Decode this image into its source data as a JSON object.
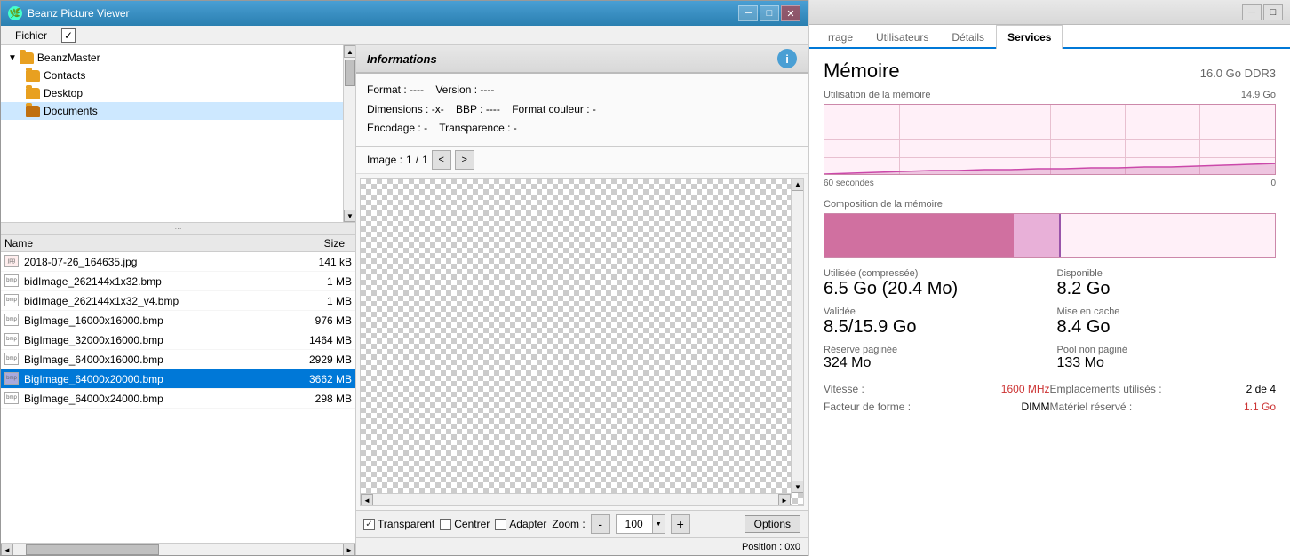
{
  "beanz": {
    "title": "Beanz Picture Viewer",
    "menu": {
      "fichier": "Fichier"
    },
    "tree": {
      "root": "BeanzMaster",
      "items": [
        {
          "name": "Contacts",
          "type": "folder"
        },
        {
          "name": "Desktop",
          "type": "folder"
        },
        {
          "name": "Documents",
          "type": "folder",
          "selected": true
        }
      ]
    },
    "file_list": {
      "headers": {
        "name": "Name",
        "size": "Size"
      },
      "files": [
        {
          "name": "2018-07-26_164635.jpg",
          "size": "141 kB",
          "selected": false
        },
        {
          "name": "bidImage_262144x1x32.bmp",
          "size": "1 MB",
          "selected": false
        },
        {
          "name": "bidImage_262144x1x32_v4.bmp",
          "size": "1 MB",
          "selected": false
        },
        {
          "name": "BigImage_16000x16000.bmp",
          "size": "976 MB",
          "selected": false
        },
        {
          "name": "BigImage_32000x16000.bmp",
          "size": "1464 MB",
          "selected": false
        },
        {
          "name": "BigImage_64000x16000.bmp",
          "size": "2929 MB",
          "selected": false
        },
        {
          "name": "BigImage_64000x20000.bmp",
          "size": "3662 MB",
          "selected": true
        },
        {
          "name": "BigImage_64000x24000.bmp",
          "size": "298 MB",
          "selected": false
        }
      ]
    },
    "info": {
      "title": "Informations",
      "format_label": "Format :",
      "format_value": "----",
      "version_label": "Version :",
      "version_value": "----",
      "dimensions_label": "Dimensions :",
      "dimensions_value": "-x-",
      "bbp_label": "BBP :",
      "bbp_value": "----",
      "color_format_label": "Format couleur :",
      "color_format_value": "-",
      "encoding_label": "Encodage :",
      "encoding_value": "-",
      "transparency_label": "Transparence :",
      "transparency_value": "-"
    },
    "image_nav": {
      "label": "Image :",
      "current": "1",
      "separator": "/",
      "total": "1"
    },
    "toolbar": {
      "transparent_label": "Transparent",
      "center_label": "Centrer",
      "adapter_label": "Adapter",
      "zoom_label": "Zoom :",
      "zoom_minus": "-",
      "zoom_value": "100",
      "zoom_plus": "+",
      "options_label": "Options"
    },
    "status": {
      "position": "Position : 0x0"
    }
  },
  "taskman": {
    "tabs": [
      {
        "label": "rrage",
        "active": false
      },
      {
        "label": "Utilisateurs",
        "active": false
      },
      {
        "label": "Détails",
        "active": false
      },
      {
        "label": "Services",
        "active": true
      }
    ],
    "memory": {
      "title": "Mémoire",
      "spec": "16.0 Go DDR3",
      "utilization_label": "Utilisation de la mémoire",
      "utilization_max": "14.9 Go",
      "utilization_min": "0",
      "time_label": "60 secondes",
      "time_value": "0",
      "composition_label": "Composition de la mémoire"
    },
    "stats": [
      {
        "label": "Utilisée (compressée)",
        "value": "6.5 Go (20.4 Mo)"
      },
      {
        "label": "Disponible",
        "value": "8.2 Go"
      },
      {
        "label": "Validée",
        "value": "8.5/15.9 Go"
      },
      {
        "label": "Mise en cache",
        "value": "8.4 Go"
      },
      {
        "label": "Réserve paginée",
        "value": "324 Mo"
      },
      {
        "label": "Pool non paginé",
        "value": "133 Mo"
      }
    ],
    "specs": [
      {
        "key": "Vitesse :",
        "value": "1600 MHz",
        "highlight": true
      },
      {
        "key": "Emplacements utilisés :",
        "value": "2 de 4",
        "highlight": false
      },
      {
        "key": "Facteur de forme :",
        "value": "DIMM",
        "highlight": false
      },
      {
        "key": "Matériel réservé :",
        "value": "1.1 Go",
        "highlight": true
      }
    ]
  }
}
